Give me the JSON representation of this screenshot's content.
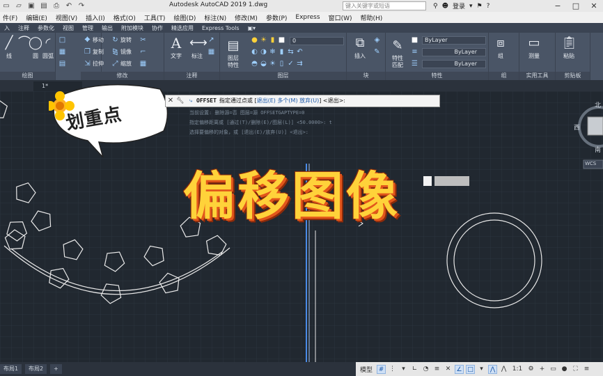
{
  "titlebar": {
    "title": "Autodesk AutoCAD 2019    1.dwg",
    "search_placeholder": "键入关键字或短语",
    "login": "登录"
  },
  "menubar": [
    "件(F)",
    "编辑(E)",
    "视图(V)",
    "插入(I)",
    "格式(O)",
    "工具(T)",
    "绘图(D)",
    "标注(N)",
    "修改(M)",
    "参数(P)",
    "Express",
    "窗口(W)",
    "帮助(H)"
  ],
  "ribbon_tabs": [
    "入",
    "注释",
    "参数化",
    "视图",
    "管理",
    "输出",
    "附加模块",
    "协作",
    "精选应用",
    "Express Tools"
  ],
  "ribbon": {
    "draw": {
      "title": "绘图",
      "line": "线",
      "circle": "圆",
      "arc": "圆弧"
    },
    "modify": {
      "title": "修改",
      "move": "移动",
      "rotate": "旋转",
      "copy": "复制",
      "mirror": "镜像",
      "stretch": "拉伸",
      "scale": "缩放"
    },
    "annotation": {
      "title": "注释",
      "text": "文字",
      "dimension": "标注"
    },
    "layers": {
      "title": "图层",
      "props": "图层\n特性",
      "layer_value": "0"
    },
    "block": {
      "title": "块",
      "insert": "插入"
    },
    "properties": {
      "title": "特性",
      "match": "特性\n匹配",
      "bylayer1": "ByLayer",
      "bylayer2": "ByLayer",
      "bylayer3": "ByLayer"
    },
    "group": {
      "title": "组",
      "label": "组"
    },
    "utilities": {
      "title": "实用工具",
      "measure": "测量"
    },
    "clipboard": {
      "title": "剪贴板",
      "paste": "粘贴"
    }
  },
  "doc_tab": "1*",
  "command": {
    "name": "OFFSET",
    "prompt": "指定通过点或 [",
    "opt1": "退出(E)",
    "opt2": "多个(M)",
    "opt3": "放弃(U)",
    "tail": "] <退出>:",
    "history": [
      "当前设置: 删除源=否  图层=源  OFFSETGAPTYPE=0",
      "指定偏移距离或 [通过(T)/删除(E)/图层(L)] <50.0000>:  t",
      "选择要偏移的对象，或 [退出(E)/放弃(U)] <退出>:"
    ]
  },
  "overlay": {
    "sticker": "划重点",
    "title": "偏移图像"
  },
  "viewcube": {
    "north": "北",
    "west": "西",
    "south": "南",
    "wcs": "WCS"
  },
  "layout_tabs": [
    "布局1",
    "布局2",
    "+"
  ],
  "status": {
    "model": "模型",
    "scale": "1:1"
  }
}
